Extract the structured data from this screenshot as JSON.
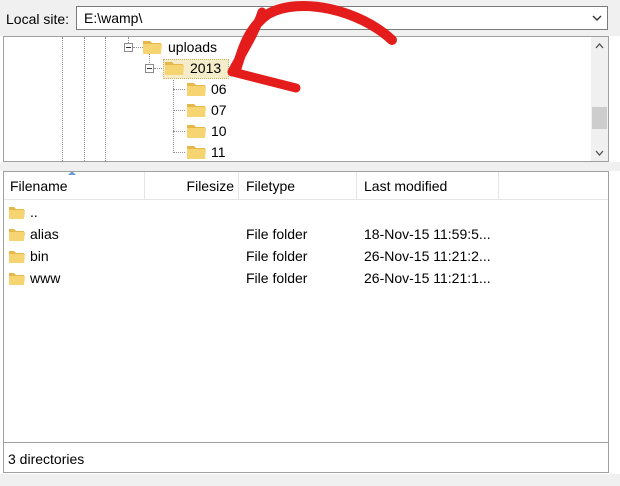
{
  "site_bar": {
    "label": "Local site:",
    "path": "E:\\wamp\\"
  },
  "tree": {
    "items": [
      {
        "label": "uploads"
      },
      {
        "label": "2013"
      },
      {
        "label": "06"
      },
      {
        "label": "07"
      },
      {
        "label": "10"
      },
      {
        "label": "11"
      }
    ]
  },
  "file_list": {
    "columns": [
      "Filename",
      "Filesize",
      "Filetype",
      "Last modified"
    ],
    "rows": [
      {
        "name": "..",
        "size": "",
        "type": "",
        "modified": ""
      },
      {
        "name": "alias",
        "size": "",
        "type": "File folder",
        "modified": "18-Nov-15 11:59:5..."
      },
      {
        "name": "bin",
        "size": "",
        "type": "File folder",
        "modified": "26-Nov-15 11:21:2..."
      },
      {
        "name": "www",
        "size": "",
        "type": "File folder",
        "modified": "26-Nov-15 11:21:1..."
      }
    ]
  },
  "status": {
    "text": "3 directories"
  },
  "colors": {
    "annotation_arrow": "#e51c1c",
    "folder": "#f3c95a",
    "selection": "#f5edc9"
  },
  "icons": [
    "folder-icon",
    "expander-icon",
    "dropdown-chevron-icon",
    "scroll-up-icon",
    "scroll-down-icon",
    "sort-ascending-icon"
  ]
}
